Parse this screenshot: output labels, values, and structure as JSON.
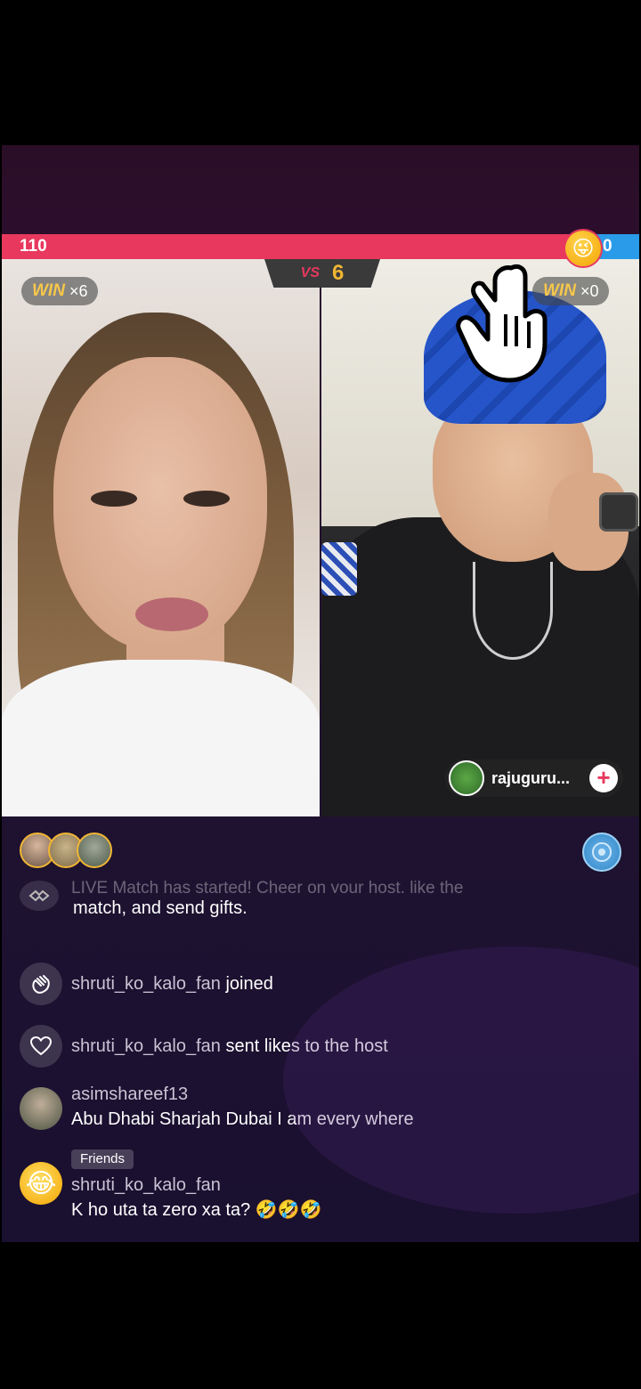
{
  "battle": {
    "left_score": "110",
    "right_score": "0",
    "timer": "6",
    "vs_label": "VS",
    "left_win_label": "WIN",
    "left_win_mult": "×6",
    "right_win_label": "WIN",
    "right_win_mult": "×0",
    "score_emoji": "😜"
  },
  "guest": {
    "name": "rajuguru...",
    "follow_label": "+"
  },
  "chat": {
    "system_faded": "LIVE Match has started! Cheer on your host, like the",
    "system_text": "match, and send gifts.",
    "messages": [
      {
        "user": "shruti_ko_kalo_fan",
        "text": "joined",
        "icon": "wave-hand-icon"
      },
      {
        "user": "shruti_ko_kalo_fan",
        "text": "sent likes to the host",
        "icon": "heart-icon"
      },
      {
        "user": "asimshareef13",
        "text": "Abu Dhabi Sharjah Dubai I am every where",
        "icon": "avatar"
      },
      {
        "badge": "Friends",
        "user": "shruti_ko_kalo_fan",
        "text": "K ho uta ta zero xa ta? 🤣🤣🤣",
        "icon": "laugh-emoji-avatar"
      }
    ]
  },
  "colors": {
    "left_team": "#e8385e",
    "right_team": "#2a9be8",
    "accent": "#f1b534"
  }
}
